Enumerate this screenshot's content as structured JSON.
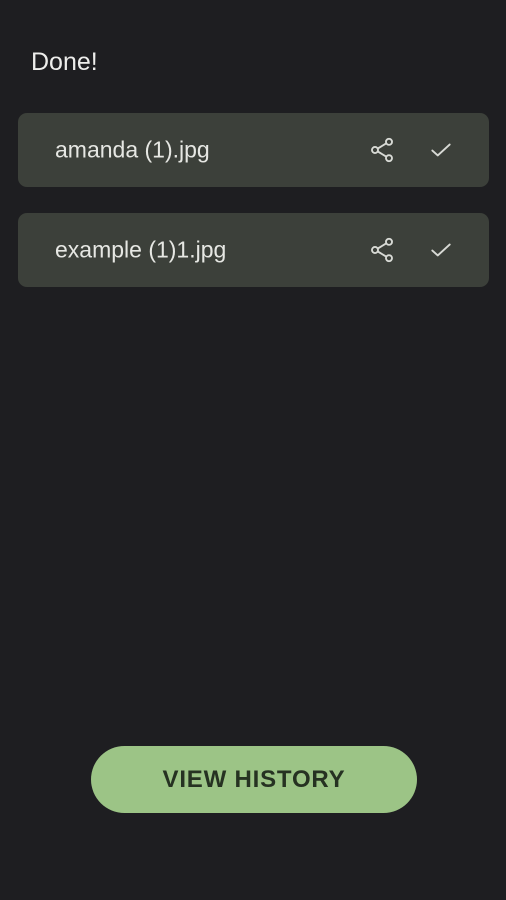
{
  "status": {
    "title": "Done!"
  },
  "files": [
    {
      "name": "amanda (1).jpg",
      "share_icon": "share-icon",
      "status_icon": "check-icon"
    },
    {
      "name": "example (1)1.jpg",
      "share_icon": "share-icon",
      "status_icon": "check-icon"
    }
  ],
  "actions": {
    "view_history_label": "VIEW HISTORY"
  },
  "colors": {
    "background": "#1e1e21",
    "card": "#3c403a",
    "accent_button": "#9cc486",
    "accent_button_text": "#263222",
    "icon": "#d8dad5"
  }
}
